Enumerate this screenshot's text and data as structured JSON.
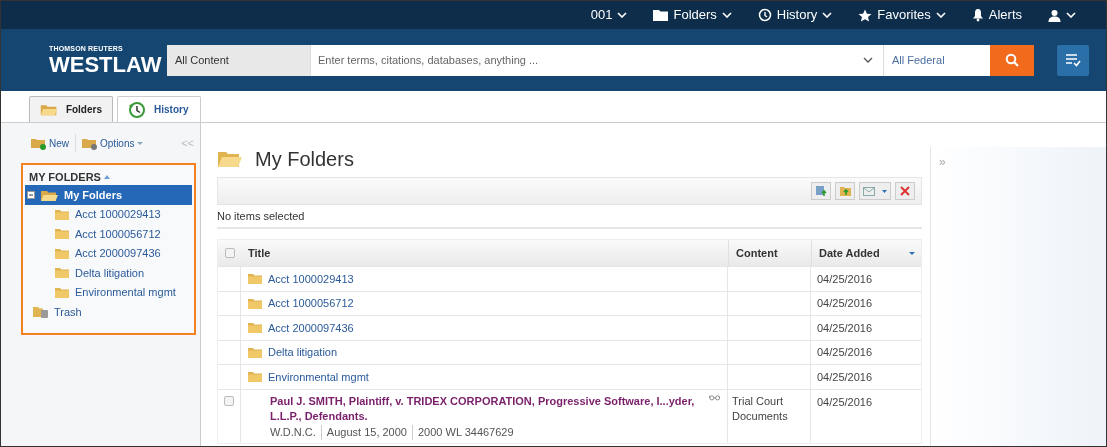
{
  "top_nav": [
    {
      "label": "001",
      "kind": "account",
      "menu": true
    },
    {
      "label": "Folders",
      "kind": "folders",
      "menu": true
    },
    {
      "label": "History",
      "kind": "history",
      "menu": true
    },
    {
      "label": "Favorites",
      "kind": "favorites",
      "menu": true
    },
    {
      "label": "Alerts",
      "kind": "alerts",
      "menu": false
    },
    {
      "kind": "user",
      "menu": true
    }
  ],
  "header": {
    "brand_top": "THOMSON REUTERS",
    "brand": "WESTLAW",
    "scope": "All Content",
    "search": {
      "placeholder": "Enter terms, citations, databases, anything ..."
    },
    "jurisdiction": "All Federal"
  },
  "tabs": [
    {
      "label": "Folders",
      "kind": "folders",
      "selected": true
    },
    {
      "label": "History",
      "kind": "history",
      "selected": false
    }
  ],
  "sidebar": {
    "toolbar": [
      {
        "label": "New",
        "kind": "new",
        "menu": false
      },
      {
        "label": "Options",
        "kind": "options",
        "menu": true
      }
    ],
    "collapse": "<<",
    "heading": "MY FOLDERS",
    "tree": [
      {
        "label": "My Folders",
        "kind": "folder",
        "selected": true,
        "expanded": true,
        "children": [
          {
            "label": "Acct 1000029413",
            "kind": "folder",
            "selected": false
          },
          {
            "label": "Acct 1000056712",
            "kind": "folder",
            "selected": false
          },
          {
            "label": "Acct 2000097436",
            "kind": "folder",
            "selected": false
          },
          {
            "label": "Delta litigation",
            "kind": "folder",
            "selected": false
          },
          {
            "label": "Environmental mgmt",
            "kind": "folder",
            "selected": false
          }
        ]
      },
      {
        "label": "Trash",
        "kind": "trash",
        "selected": false
      }
    ]
  },
  "main": {
    "title": "My Folders",
    "selection_status": "No items selected",
    "select_all_checked": false,
    "columns": [
      "Title",
      "Content",
      "Date Added"
    ],
    "rows": [
      {
        "kind": "folder",
        "title": "Acct 1000029413",
        "date": "04/25/2016"
      },
      {
        "kind": "folder",
        "title": "Acct 1000056712",
        "date": "04/25/2016"
      },
      {
        "kind": "folder",
        "title": "Acct 2000097436",
        "date": "04/25/2016"
      },
      {
        "kind": "folder",
        "title": "Delta litigation",
        "date": "04/25/2016"
      },
      {
        "kind": "folder",
        "title": "Environmental mgmt",
        "date": "04/25/2016"
      },
      {
        "kind": "document",
        "checked": false,
        "title": "Paul J. SMITH, Plaintiff, v. TRIDEX CORPORATION, Progressive Software, I...yder, L.L.P., Defendants.",
        "content": "Trial Court Documents",
        "date": "04/25/2016",
        "meta": [
          "W.D.N.C.",
          "August 15, 2000",
          "2000 WL 34467629"
        ]
      }
    ]
  },
  "right_pane": {
    "expand": "»"
  }
}
